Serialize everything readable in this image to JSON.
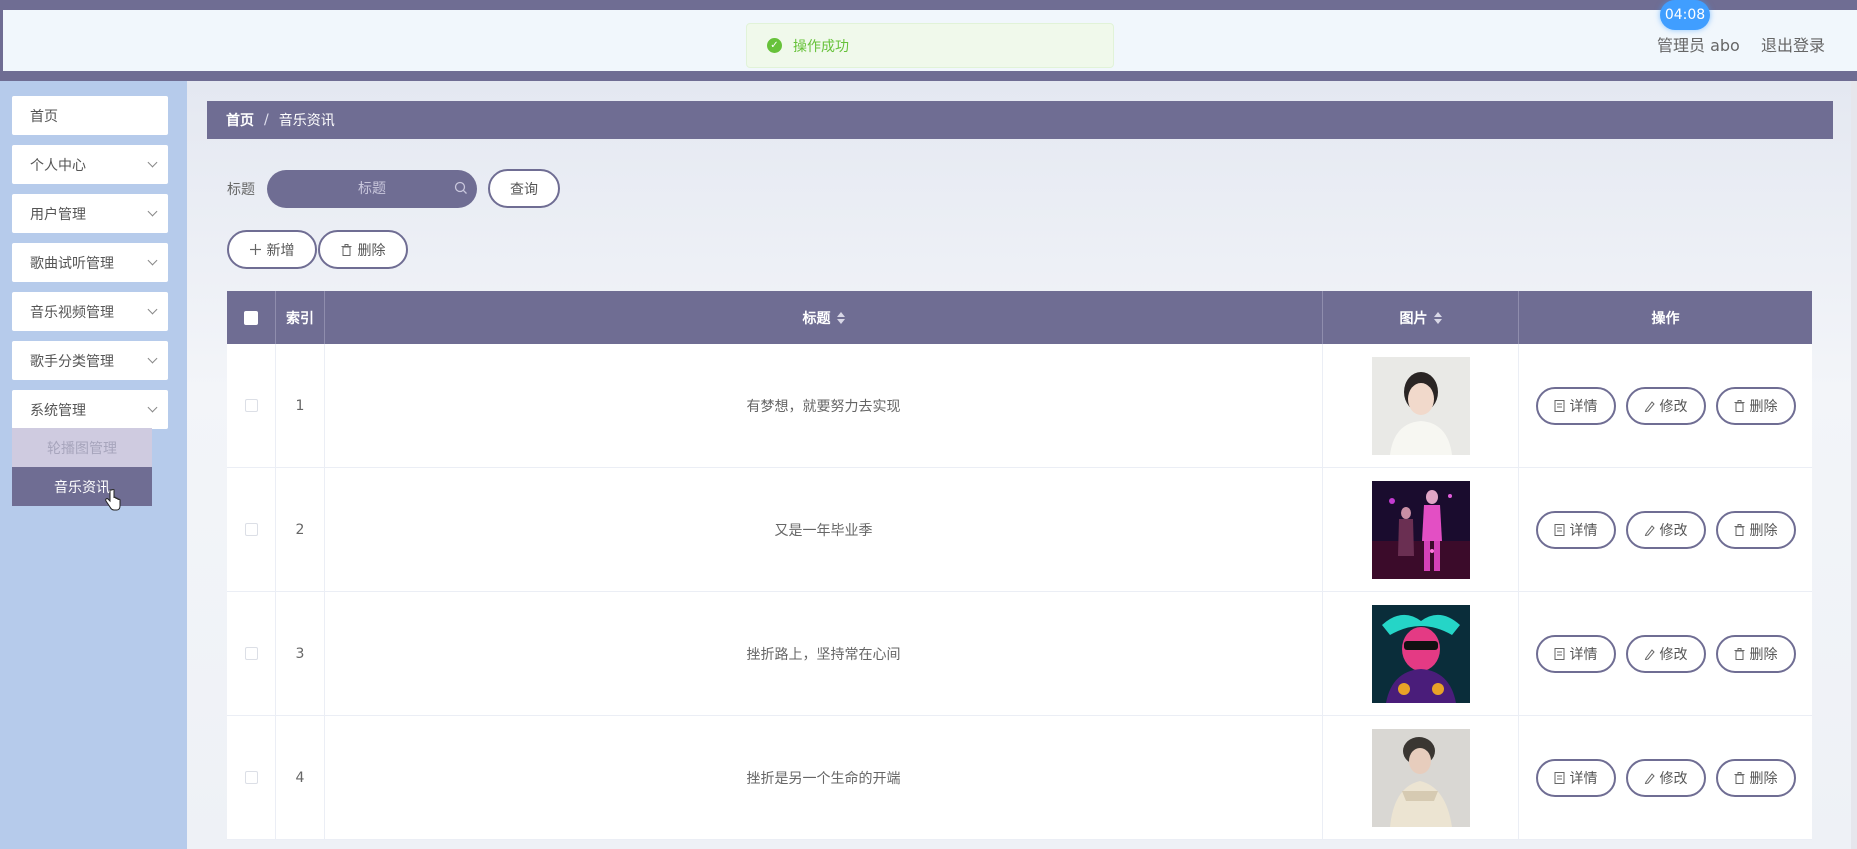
{
  "header": {
    "toast": "操作成功",
    "clock": "04:08",
    "user_label": "管理员 abo",
    "logout_label": "退出登录"
  },
  "sidebar": {
    "items": [
      {
        "label": "首页",
        "has_chevron": false
      },
      {
        "label": "个人中心",
        "has_chevron": true
      },
      {
        "label": "用户管理",
        "has_chevron": true
      },
      {
        "label": "歌曲试听管理",
        "has_chevron": true
      },
      {
        "label": "音乐视频管理",
        "has_chevron": true
      },
      {
        "label": "歌手分类管理",
        "has_chevron": true
      },
      {
        "label": "系统管理",
        "has_chevron": true
      }
    ],
    "submenu": [
      {
        "label": "轮播图管理",
        "active": false
      },
      {
        "label": "音乐资讯",
        "active": true
      }
    ]
  },
  "breadcrumb": {
    "home": "首页",
    "separator": "/",
    "current": "音乐资讯"
  },
  "search": {
    "label": "标题",
    "placeholder": "标题",
    "query_button": "查询"
  },
  "actions": {
    "add_label": "新增",
    "delete_label": "删除"
  },
  "table": {
    "columns": {
      "index": "索引",
      "title": "标题",
      "image": "图片",
      "ops": "操作"
    },
    "row_actions": {
      "detail": "详情",
      "edit": "修改",
      "delete": "删除"
    },
    "rows": [
      {
        "index": "1",
        "title": "有梦想，就要努力去实现"
      },
      {
        "index": "2",
        "title": "又是一年毕业季"
      },
      {
        "index": "3",
        "title": "挫折路上，坚持常在心间"
      },
      {
        "index": "4",
        "title": "挫折是另一个生命的开端"
      }
    ]
  },
  "colors": {
    "accent": "#6f6d93",
    "sidebar_bg": "#b6cbeb",
    "success": "#67c23a",
    "clock": "#409eff"
  }
}
